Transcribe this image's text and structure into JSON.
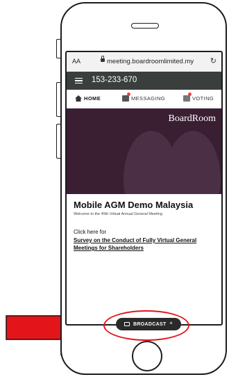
{
  "browser": {
    "aa_label": "AA",
    "url": "meeting.boardroomlimited.my",
    "reload_icon": "refresh-icon"
  },
  "topnav": {
    "meeting_id": "153-233-670",
    "menu_icon": "hamburger-icon"
  },
  "tabs": [
    {
      "label": "HOME",
      "icon": "home-icon",
      "active": true
    },
    {
      "label": "MESSAGING",
      "icon": "messaging-icon",
      "badge": true
    },
    {
      "label": "VOTING",
      "icon": "voting-icon",
      "badge": true
    }
  ],
  "hero": {
    "logo_text": "BoardRoom"
  },
  "content": {
    "title": "Mobile AGM Demo Malaysia",
    "subtitle": "Welcome to the 45th Virtual Annual General Meeting",
    "click_text": "Click here for",
    "survey_link": "Survey on the Conduct of Fully Virtual General Meetings for Shareholders"
  },
  "broadcast": {
    "label": "BROADCAST",
    "icon": "cast-icon",
    "caret": "^"
  },
  "colors": {
    "annotation_red": "#e3151a",
    "nav_bg": "#3a3f3d",
    "hero_bg": "#3a1f33",
    "badge_red": "#e8443a"
  }
}
